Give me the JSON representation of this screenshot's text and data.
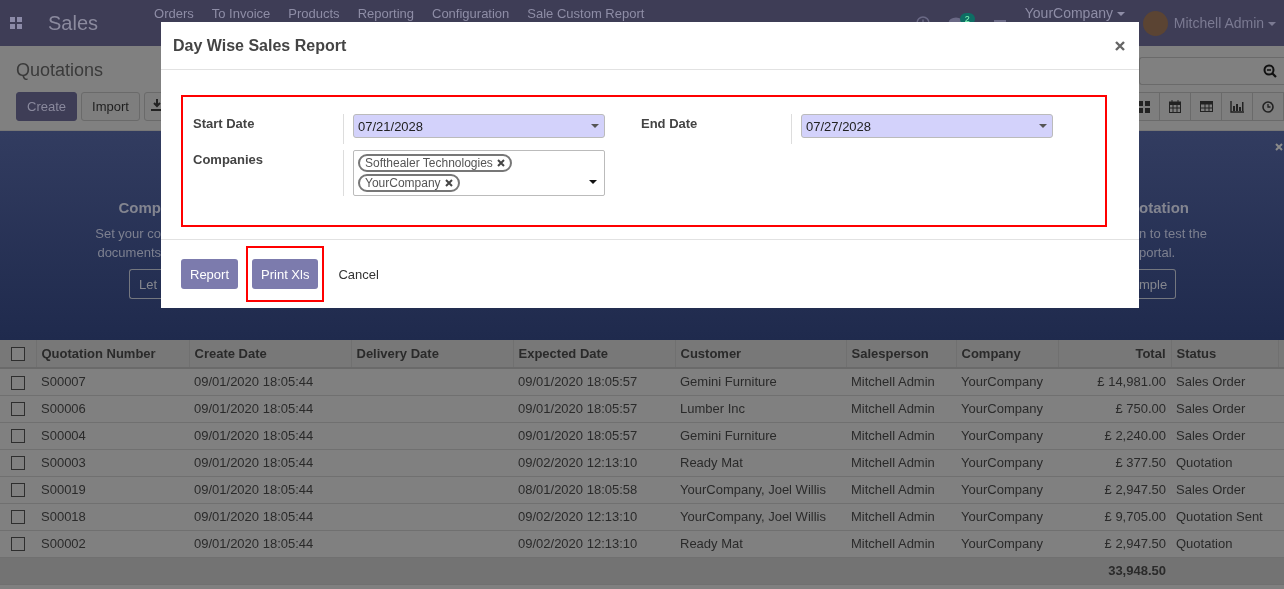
{
  "nav": {
    "app_title": "Sales",
    "menu": [
      "Orders",
      "To Invoice",
      "Products",
      "Reporting",
      "Configuration",
      "Sale Custom Report"
    ],
    "chat_count": "2",
    "company": "YourCompany",
    "user": "Mitchell Admin"
  },
  "control_panel": {
    "title": "Quotations",
    "buttons": [
      "Create",
      "Import"
    ]
  },
  "banner": {
    "left": {
      "heading": "Comp",
      "lines": [
        "Set your co",
        "documents"
      ],
      "button": "Let"
    },
    "right": {
      "heading": "otation",
      "lines": [
        "n to test the",
        "portal."
      ],
      "button": "mple"
    }
  },
  "table": {
    "all_selected": false,
    "columns": [
      "Quotation Number",
      "Create Date",
      "Delivery Date",
      "Expected Date",
      "Customer",
      "Salesperson",
      "Company",
      "Total",
      "Status"
    ],
    "rows": [
      {
        "selected": false,
        "cells": [
          "S00007",
          "09/01/2020 18:05:44",
          "",
          "09/01/2020 18:05:57",
          "Gemini Furniture",
          "Mitchell Admin",
          "YourCompany",
          "£ 14,981.00",
          "Sales Order"
        ]
      },
      {
        "selected": false,
        "cells": [
          "S00006",
          "09/01/2020 18:05:44",
          "",
          "09/01/2020 18:05:57",
          "Lumber Inc",
          "Mitchell Admin",
          "YourCompany",
          "£ 750.00",
          "Sales Order"
        ]
      },
      {
        "selected": false,
        "cells": [
          "S00004",
          "09/01/2020 18:05:44",
          "",
          "09/01/2020 18:05:57",
          "Gemini Furniture",
          "Mitchell Admin",
          "YourCompany",
          "£ 2,240.00",
          "Sales Order"
        ]
      },
      {
        "selected": false,
        "cells": [
          "S00003",
          "09/01/2020 18:05:44",
          "",
          "09/02/2020 12:13:10",
          "Ready Mat",
          "Mitchell Admin",
          "YourCompany",
          "£ 377.50",
          "Quotation"
        ]
      },
      {
        "selected": false,
        "cells": [
          "S00019",
          "09/01/2020 18:05:44",
          "",
          "08/01/2020 18:05:58",
          "YourCompany, Joel Willis",
          "Mitchell Admin",
          "YourCompany",
          "£ 2,947.50",
          "Sales Order"
        ]
      },
      {
        "selected": false,
        "cells": [
          "S00018",
          "09/01/2020 18:05:44",
          "",
          "09/02/2020 12:13:10",
          "YourCompany, Joel Willis",
          "Mitchell Admin",
          "YourCompany",
          "£ 9,705.00",
          "Quotation Sent"
        ]
      },
      {
        "selected": false,
        "cells": [
          "S00002",
          "09/01/2020 18:05:44",
          "",
          "09/02/2020 12:13:10",
          "Ready Mat",
          "Mitchell Admin",
          "YourCompany",
          "£ 2,947.50",
          "Quotation"
        ]
      }
    ],
    "total": "33,948.50"
  },
  "dialog": {
    "title": "Day Wise Sales Report",
    "form_highlighted": true,
    "start_date": {
      "label": "Start Date",
      "value": "07/21/2028"
    },
    "companies": {
      "label": "Companies",
      "tags": [
        "Softhealer Technologies",
        "YourCompany"
      ]
    },
    "end_date": {
      "label": "End Date",
      "value": "07/27/2028"
    },
    "buttons": [
      {
        "label": "Report",
        "kind": "primary",
        "highlighted": false
      },
      {
        "label": "Print Xls",
        "kind": "primary",
        "highlighted": true
      },
      {
        "label": "Cancel",
        "kind": "link",
        "highlighted": false
      }
    ]
  }
}
